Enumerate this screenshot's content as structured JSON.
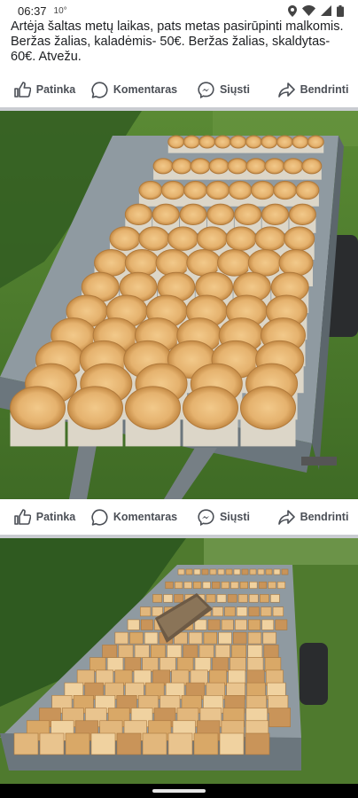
{
  "status_bar": {
    "time": "06:37",
    "temperature": "10°",
    "icons": [
      "location-icon",
      "wifi-icon",
      "signal-icon",
      "battery-icon"
    ]
  },
  "post": {
    "text": "Artėja šaltas metų laikas, pats metas pasirūpinti malkomis. Beržas žalias, kaladėmis- 50€. Beržas žalias, skaldytas-60€. Atvežu."
  },
  "actions": {
    "like": "Patinka",
    "comment": "Komentaras",
    "send": "Siųsti",
    "share": "Bendrinti"
  },
  "photos": [
    {
      "subject": "trailer-with-birch-log-rounds"
    },
    {
      "subject": "trailer-with-split-birch-firewood"
    }
  ],
  "colors": {
    "action_text": "#4b4f56",
    "divider": "#c9ccd1",
    "grass": "#4f7a2e",
    "birch_wood": "#d9a867"
  }
}
